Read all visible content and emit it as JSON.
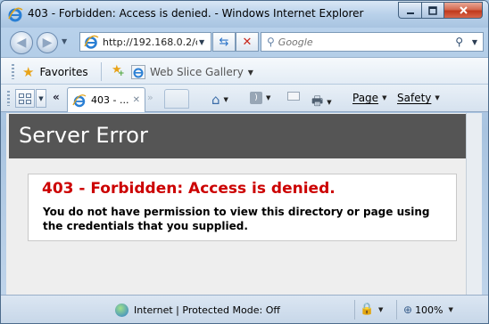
{
  "window": {
    "title": "403 - Forbidden: Access is denied. - Windows Internet Explorer"
  },
  "address": {
    "url": "http://192.168.0.2/c",
    "search_placeholder": "Google"
  },
  "favorites_bar": {
    "favorites_label": "Favorites",
    "web_slice_label": "Web Slice Gallery"
  },
  "tabs": {
    "active_tab_label": "403 - ..."
  },
  "command_bar": {
    "page_label": "Page",
    "safety_label": "Safety"
  },
  "page": {
    "header": "Server Error",
    "error_title": "403 - Forbidden: Access is denied.",
    "error_message": "You do not have permission to view this directory or page using the credentials that you supplied."
  },
  "status_bar": {
    "zone_text": "Internet | Protected Mode: Off",
    "zoom_text": "100%"
  },
  "colors": {
    "header_bg": "#555555",
    "error_title": "#cc0000",
    "content_bg": "#eeeeee"
  },
  "icons": [
    "ie-logo-icon",
    "back-arrow-icon",
    "forward-arrow-icon",
    "refresh-icon",
    "stop-icon",
    "search-icon",
    "star-icon",
    "add-favorites-icon",
    "quick-tabs-icon",
    "home-icon",
    "feeds-icon",
    "mail-icon",
    "print-icon",
    "globe-icon",
    "protected-mode-icon",
    "zoom-icon"
  ]
}
